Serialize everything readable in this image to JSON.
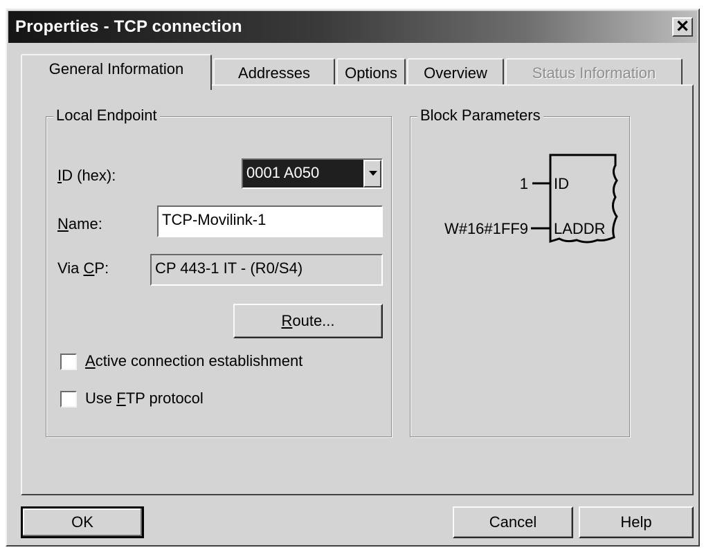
{
  "window": {
    "title": "Properties - TCP connection",
    "close_glyph": "✕"
  },
  "tabs": [
    {
      "label": "General Information",
      "state": "active"
    },
    {
      "label": "Addresses",
      "state": "normal"
    },
    {
      "label": "Options",
      "state": "normal"
    },
    {
      "label": "Overview",
      "state": "normal"
    },
    {
      "label": "Status Information",
      "state": "disabled"
    }
  ],
  "local_endpoint": {
    "group_label": "Local Endpoint",
    "id_label_key": "I",
    "id_label_rest": "D (hex):",
    "id_value": "0001 A050",
    "name_label_key": "N",
    "name_label_rest": "ame:",
    "name_value": "TCP-Movilink-1",
    "via_label_pre": "Via ",
    "via_label_key": "C",
    "via_label_rest": "P:",
    "via_value": "CP 443-1 IT - (R0/S4)",
    "route_key": "R",
    "route_rest": "oute...",
    "active_key": "A",
    "active_rest": "ctive connection establishment",
    "active_checked": false,
    "ftp_pre": "Use ",
    "ftp_key": "F",
    "ftp_rest": "TP protocol",
    "ftp_checked": false
  },
  "block_parameters": {
    "group_label": "Block Parameters",
    "inputs": [
      {
        "value": "1",
        "pin": "ID"
      },
      {
        "value": "W#16#1FF9",
        "pin": "LADDR"
      }
    ]
  },
  "buttons": {
    "ok": "OK",
    "cancel": "Cancel",
    "help": "Help"
  }
}
